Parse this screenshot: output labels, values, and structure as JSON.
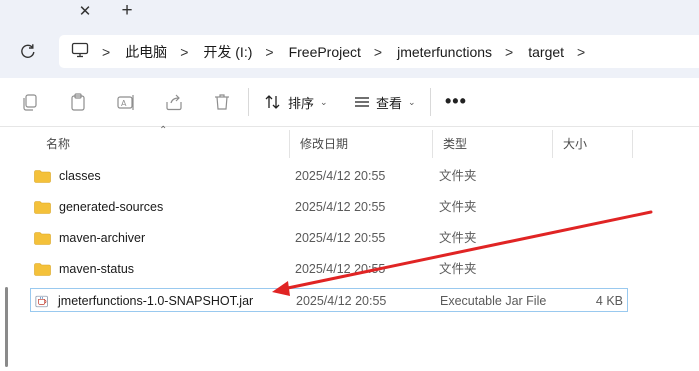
{
  "tabbar": {
    "close_glyph": "✕",
    "new_tab_glyph": "+"
  },
  "address": {
    "crumbs": [
      "此电脑",
      "开发 (I:)",
      "FreeProject",
      "jmeterfunctions",
      "target"
    ],
    "separator": ">"
  },
  "toolbar": {
    "icons": [
      "copy-icon",
      "paste-icon",
      "rename-icon",
      "share-icon",
      "delete-icon"
    ],
    "sort_label": "排序",
    "view_label": "查看",
    "more_label": "•••"
  },
  "columns": {
    "name": "名称",
    "modified": "修改日期",
    "type": "类型",
    "size": "大小"
  },
  "files": [
    {
      "name": "classes",
      "modified": "2025/4/12 20:55",
      "type": "文件夹",
      "size": "",
      "kind": "folder"
    },
    {
      "name": "generated-sources",
      "modified": "2025/4/12 20:55",
      "type": "文件夹",
      "size": "",
      "kind": "folder"
    },
    {
      "name": "maven-archiver",
      "modified": "2025/4/12 20:55",
      "type": "文件夹",
      "size": "",
      "kind": "folder"
    },
    {
      "name": "maven-status",
      "modified": "2025/4/12 20:55",
      "type": "文件夹",
      "size": "",
      "kind": "folder"
    },
    {
      "name": "jmeterfunctions-1.0-SNAPSHOT.jar",
      "modified": "2025/4/12 20:55",
      "type": "Executable Jar File",
      "size": "4 KB",
      "kind": "jar"
    }
  ],
  "colors": {
    "chrome_bg": "#eef1f8",
    "folder": "#f4c13a",
    "selection_border": "#99c9ef",
    "annotation_arrow": "#e02424"
  }
}
